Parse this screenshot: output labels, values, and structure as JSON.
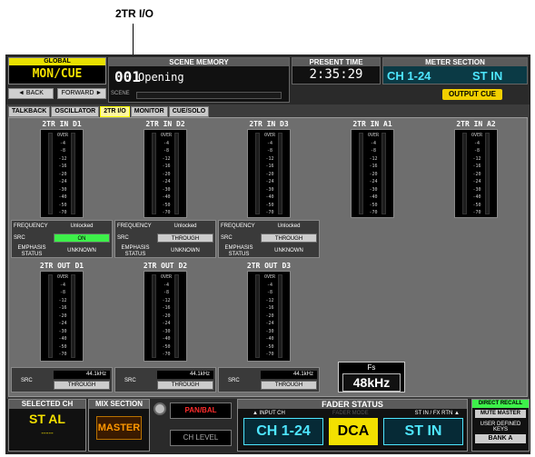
{
  "callout": "2TR I/O",
  "global": {
    "label": "GLOBAL",
    "value": "MON/CUE",
    "back": "◄ BACK",
    "forward": "FORWARD ►"
  },
  "scene": {
    "header": "SCENE MEMORY",
    "number": "001",
    "title": "Opening",
    "label": "SCENE"
  },
  "present_time": {
    "header": "PRESENT TIME",
    "value": "2:35:29"
  },
  "meter_section": {
    "header": "METER SECTION",
    "left": "CH 1-24",
    "right": "ST IN",
    "output_cue": "OUTPUT CUE"
  },
  "tabs": [
    "TALKBACK",
    "OSCILLATOR",
    "2TR I/O",
    "MONITOR",
    "CUE/SOLO"
  ],
  "scale": [
    "OVER",
    "-4",
    "-8",
    "-12",
    "-16",
    "-20",
    "-24",
    "-30",
    "-40",
    "-50",
    "-70"
  ],
  "inputs": [
    {
      "title": "2TR IN D1",
      "freq_label": "FREQUENCY",
      "freq": "Unlocked",
      "src_label": "SRC",
      "src": "ON",
      "emph_label": "EMPHASIS STATUS",
      "emph": "UNKNOWN"
    },
    {
      "title": "2TR IN D2",
      "freq_label": "FREQUENCY",
      "freq": "Unlocked",
      "src_label": "SRC",
      "src": "THROUGH",
      "emph_label": "EMPHASIS STATUS",
      "emph": "UNKNOWN"
    },
    {
      "title": "2TR IN D3",
      "freq_label": "FREQUENCY",
      "freq": "Unlocked",
      "src_label": "SRC",
      "src": "THROUGH",
      "emph_label": "EMPHASIS STATUS",
      "emph": "UNKNOWN"
    },
    {
      "title": "2TR IN A1"
    },
    {
      "title": "2TR IN A2"
    }
  ],
  "outputs": [
    {
      "title": "2TR OUT D1",
      "src_label": "SRC",
      "fs": "44.1kHz",
      "src": "THROUGH"
    },
    {
      "title": "2TR OUT D2",
      "src_label": "SRC",
      "fs": "44.1kHz",
      "src": "THROUGH"
    },
    {
      "title": "2TR OUT D3",
      "src_label": "SRC",
      "fs": "44.1kHz",
      "src": "THROUGH"
    }
  ],
  "fs": {
    "label": "Fs",
    "value": "48kHz"
  },
  "bottom": {
    "selected_ch_label": "SELECTED CH",
    "selected_ch": "ST AL",
    "selected_ch_sub": "-----",
    "mix_label": "MIX SECTION",
    "mix": "MASTER",
    "pan": "PAN/BAL",
    "ch_level": "CH LEVEL",
    "fader_label": "FADER STATUS",
    "input_ch_label": "▲ INPUT CH",
    "fader_mode_label": "FADER MODE",
    "st_in_label": "ST IN / FX RTN ▲",
    "input_ch": "CH 1-24",
    "fader_mode": "DCA",
    "st_in": "ST IN",
    "direct_recall": "DIRECT RECALL",
    "mute_master": "MUTE MASTER",
    "user_keys": "USER DEFINED KEYS",
    "bank": "BANK A"
  }
}
